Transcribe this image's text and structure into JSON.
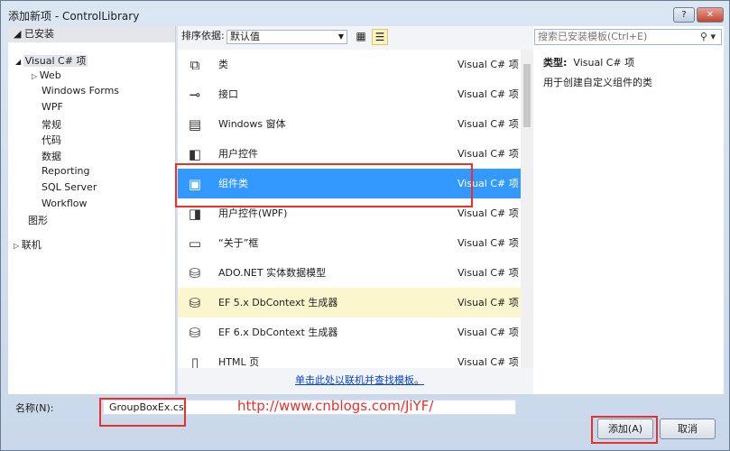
{
  "window": {
    "title": "添加新项 - ControlLibrary",
    "help": "?",
    "close": "✕"
  },
  "left": {
    "header": "已安装",
    "tree": [
      {
        "label": "Visual C# 项",
        "expander": "◢"
      },
      {
        "label": "Web",
        "expander": "▷"
      },
      {
        "label": "Windows Forms"
      },
      {
        "label": "WPF"
      },
      {
        "label": "常规"
      },
      {
        "label": "代码"
      },
      {
        "label": "数据"
      },
      {
        "label": "Reporting"
      },
      {
        "label": "SQL Server"
      },
      {
        "label": "Workflow"
      },
      {
        "label": "图形"
      },
      {
        "label": "联机",
        "expander": "▷"
      }
    ]
  },
  "toolbar": {
    "sort_label": "排序依据:",
    "sort_value": "默认值"
  },
  "templates": [
    {
      "name": "类",
      "type": "Visual C# 项",
      "icon": "class-icon"
    },
    {
      "name": "接口",
      "type": "Visual C# 项",
      "icon": "interface-icon"
    },
    {
      "name": "Windows 窗体",
      "type": "Visual C# 项",
      "icon": "form-icon"
    },
    {
      "name": "用户控件",
      "type": "Visual C# 项",
      "icon": "user-control-icon"
    },
    {
      "name": "组件类",
      "type": "Visual C# 项",
      "icon": "component-icon"
    },
    {
      "name": "用户控件(WPF)",
      "type": "Visual C# 项",
      "icon": "wpf-control-icon"
    },
    {
      "name": "“关于”框",
      "type": "Visual C# 项",
      "icon": "about-box-icon"
    },
    {
      "name": "ADO.NET 实体数据模型",
      "type": "Visual C# 项",
      "icon": "data-model-icon"
    },
    {
      "name": "EF 5.x DbContext 生成器",
      "type": "Visual C# 项",
      "icon": "data-model-icon"
    },
    {
      "name": "EF 6.x DbContext 生成器",
      "type": "Visual C# 项",
      "icon": "data-model-icon"
    },
    {
      "name": "HTML 页",
      "type": "Visual C# 项",
      "icon": "page-icon"
    }
  ],
  "online_link": "单击此处以联机并查找模板。",
  "search": {
    "placeholder": "搜索已安装模板(Ctrl+E)"
  },
  "details": {
    "type_label": "类型:",
    "type_value": "Visual C# 项",
    "description": "用于创建自定义组件的类"
  },
  "name_field": {
    "label": "名称(N):",
    "value": "GroupBoxEx.cs"
  },
  "watermark": "http://www.cnblogs.com/JiYF/",
  "buttons": {
    "add": "添加(A)",
    "cancel": "取消"
  },
  "colors": {
    "selection": "#3399ff",
    "hover": "#fcf6cf",
    "highlight_box": "#e8302e"
  }
}
